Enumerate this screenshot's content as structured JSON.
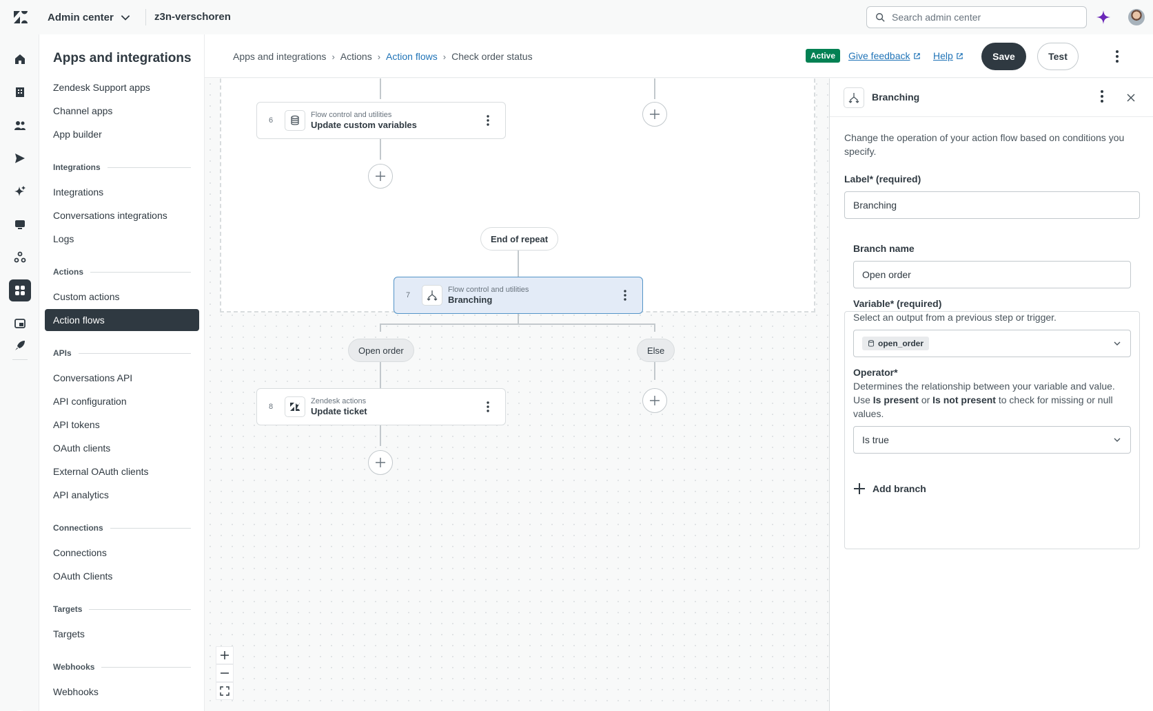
{
  "topbar": {
    "product": "Admin center",
    "account": "z3n-verschoren",
    "search_placeholder": "Search admin center"
  },
  "sidebar": {
    "title": "Apps and integrations",
    "items_top": [
      "Zendesk Support apps",
      "Channel apps",
      "App builder"
    ],
    "groups": {
      "integrations": {
        "label": "Integrations",
        "items": [
          "Integrations",
          "Conversations integrations",
          "Logs"
        ]
      },
      "actions": {
        "label": "Actions",
        "items": [
          "Custom actions",
          "Action flows"
        ]
      },
      "apis": {
        "label": "APIs",
        "items": [
          "Conversations API",
          "API configuration",
          "API tokens",
          "OAuth clients",
          "External OAuth clients",
          "API analytics"
        ]
      },
      "connections": {
        "label": "Connections",
        "items": [
          "Connections",
          "OAuth Clients"
        ]
      },
      "targets": {
        "label": "Targets",
        "items": [
          "Targets"
        ]
      },
      "webhooks": {
        "label": "Webhooks",
        "items": [
          "Webhooks"
        ]
      }
    },
    "active_item": "Action flows"
  },
  "header": {
    "breadcrumbs": [
      "Apps and integrations",
      "Actions",
      "Action flows",
      "Check order status"
    ],
    "status_badge": "Active",
    "feedback_link": "Give feedback",
    "help_link": "Help",
    "save_label": "Save",
    "test_label": "Test"
  },
  "canvas": {
    "steps": [
      {
        "number": "6",
        "category": "Flow control and utilities",
        "name": "Update custom variables",
        "icon": "database-icon"
      },
      {
        "number": "7",
        "category": "Flow control and utilities",
        "name": "Branching",
        "icon": "branch-icon"
      },
      {
        "number": "8",
        "category": "Zendesk actions",
        "name": "Update ticket",
        "icon": "zendesk-icon"
      }
    ],
    "end_of_repeat": "End of repeat",
    "branch_labels": [
      "Open order",
      "Else"
    ]
  },
  "panel": {
    "title": "Branching",
    "description": "Change the operation of your action flow based on conditions you specify.",
    "label_field": {
      "label": "Label* (required)",
      "value": "Branching"
    },
    "branch": {
      "name_label": "Branch name",
      "name_value": "Open order",
      "variable_label": "Variable* (required)",
      "variable_hint": "Select an output from a previous step or trigger.",
      "variable_value": "open_order",
      "operator_label": "Operator*",
      "operator_hint_1": "Determines the relationship between your variable and value. Use ",
      "operator_hint_b1": "Is present",
      "operator_hint_2": " or ",
      "operator_hint_b2": "Is not present",
      "operator_hint_3": " to check for missing or null values.",
      "operator_value": "Is true"
    },
    "add_branch": "Add branch"
  },
  "colors": {
    "accent": "#1f73b7",
    "dark": "#2f3941",
    "active_badge": "#038153",
    "selected_step": "#e3ebf7",
    "ai_star": "#6a27b8"
  }
}
